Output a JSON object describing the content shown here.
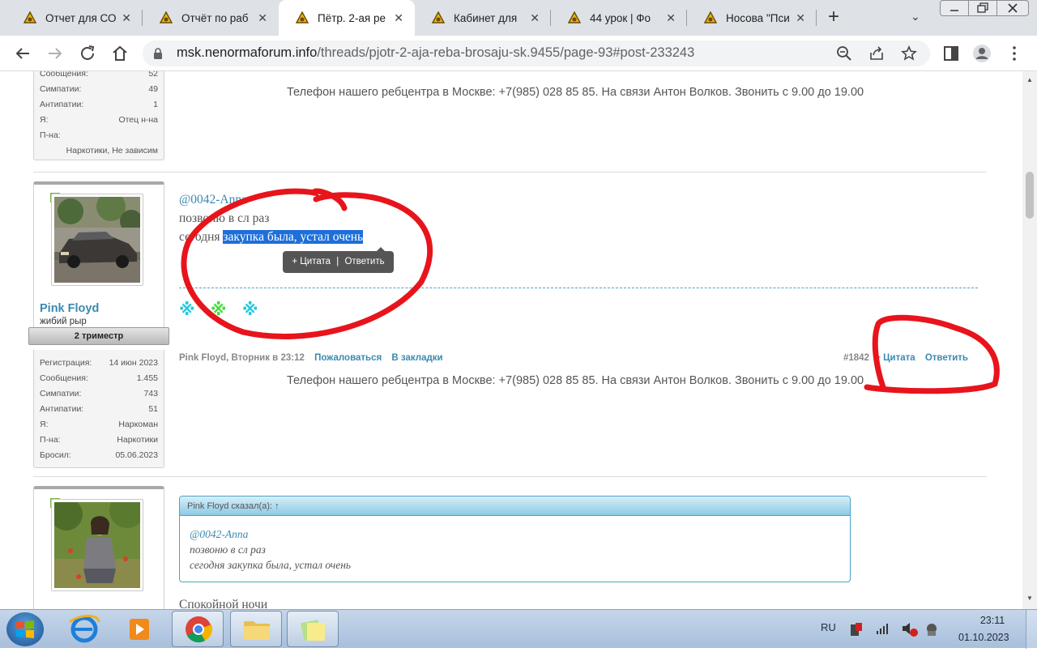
{
  "browser": {
    "tabs": [
      {
        "title": "Отчет для СО",
        "active": false
      },
      {
        "title": "Отчёт по раб",
        "active": false
      },
      {
        "title": "Пётр. 2-ая ре",
        "active": true
      },
      {
        "title": "Кабинет для",
        "active": false
      },
      {
        "title": "44 урок | Фо",
        "active": false
      },
      {
        "title": "Носова \"Пси",
        "active": false
      }
    ],
    "tab_close_glyph": "✕",
    "new_tab_glyph": "+",
    "tab_list_glyph": "⌄",
    "url_host": "msk.nenormaforum.info",
    "url_path": "/threads/pjotr-2-aja-reba-brosaju-sk.9455/page-93#post-233243"
  },
  "prev_post": {
    "stats": [
      {
        "label": "Сообщения:",
        "value": "52"
      },
      {
        "label": "Симпатии:",
        "value": "49"
      },
      {
        "label": "Антипатии:",
        "value": "1"
      },
      {
        "label": "Я:",
        "value": "Отец н-на"
      },
      {
        "label": "П-на:",
        "value": ""
      }
    ],
    "pna_value": "Наркотики, Не зависим",
    "phone_line": "Телефон нашего ребцентра в Москве: +7(985) 028 85 85. На связи Антон Волков. Звонить с 9.00 до 19.00"
  },
  "post": {
    "username": "Pink Floyd",
    "usertitle": "жибий рыр",
    "rank": "2 триместр",
    "stats": [
      {
        "label": "Регистрация:",
        "value": "14 июн 2023"
      },
      {
        "label": "Сообщения:",
        "value": "1.455"
      },
      {
        "label": "Симпатии:",
        "value": "743"
      },
      {
        "label": "Антипатии:",
        "value": "51"
      },
      {
        "label": "Я:",
        "value": "Наркоман"
      },
      {
        "label": "П-на:",
        "value": "Наркотики"
      },
      {
        "label": "Бросил:",
        "value": "05.06.2023"
      }
    ],
    "mention": "@0042-Anna",
    "line1": "позвоню в сл раз",
    "line2_plain": "сегодня ",
    "line2_selected": "закупка была, устал очень",
    "popup_quote": "+ Цитата",
    "popup_sep": "|",
    "popup_reply": "Ответить",
    "signature_stars": [
      "※",
      "※",
      "※"
    ],
    "signature_colors": [
      "#1ec9e0",
      "#3fe03a",
      "#1ec9e0"
    ],
    "meta_author": "Pink Floyd, Вторник в 23:12",
    "report_link": "Пожаловаться",
    "bookmark_link": "В закладки",
    "post_number": "#1842",
    "quote_link": "+ Цитата",
    "reply_link": "Ответить",
    "phone_line": "Телефон нашего ребцентра в Москве: +7(985) 028 85 85. На связи Антон Волков. Звонить с 9.00 до 19.00"
  },
  "next_post": {
    "quote_header": "Pink Floyd сказал(а): ↑",
    "quote_mention": "@0042-Anna",
    "quote_line1": "позвоню в сл раз",
    "quote_line2": "сегодня закупка была, устал очень",
    "reply_text": "Спокойной ночи"
  },
  "taskbar": {
    "lang": "RU",
    "time": "23:11",
    "date": "01.10.2023"
  },
  "colors": {
    "accent_link": "#3a8ab0",
    "selection": "#1e6fd9",
    "annotation_red": "#e8141c"
  }
}
